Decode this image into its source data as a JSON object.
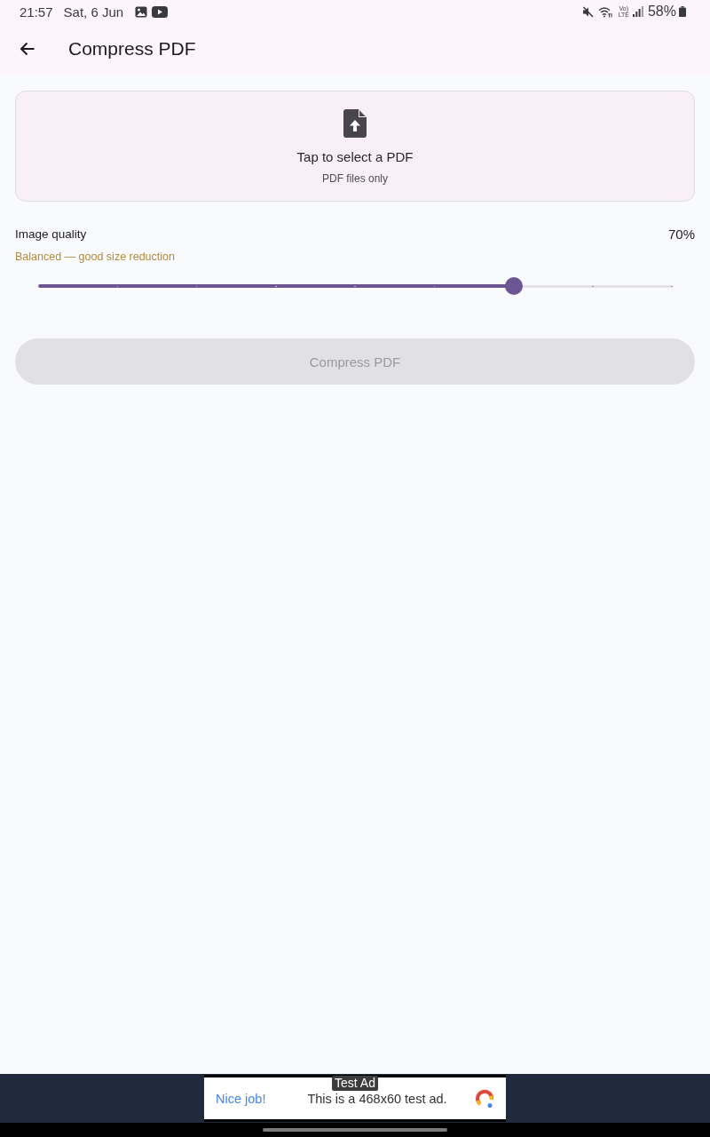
{
  "status_bar": {
    "time": "21:57",
    "date": "Sat, 6 Jun",
    "volte": {
      "top": "Vo)",
      "bottom": "LTE"
    },
    "battery": "58%"
  },
  "app_bar": {
    "title": "Compress PDF"
  },
  "file_picker": {
    "title": "Tap to select a PDF",
    "hint": "PDF files only"
  },
  "quality": {
    "label": "Image quality",
    "value": "70%",
    "description": "Balanced — good size reduction",
    "level": 0.75
  },
  "compress_button": {
    "label": "Compress PDF",
    "disabled": true
  },
  "ad_banner": {
    "badge": "Test Ad",
    "headline": "Nice job!",
    "text": "This is a 468x60 test ad."
  }
}
